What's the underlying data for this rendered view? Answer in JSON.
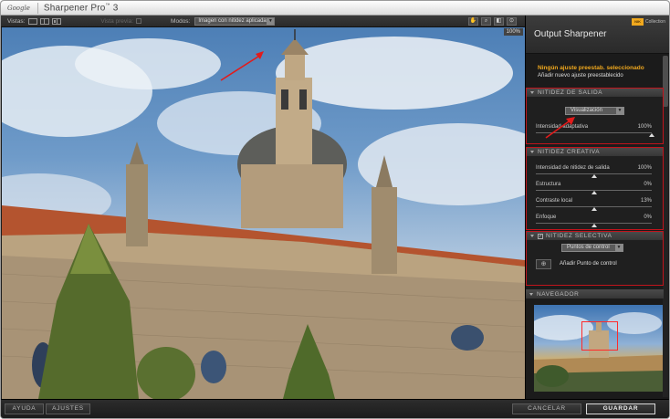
{
  "titlebar": {
    "brand": "Google",
    "app_title": "Sharpener Pro",
    "app_title_tm": "™",
    "app_version": " 3"
  },
  "toolbar": {
    "views_label": "Vistas:",
    "preview_label": "Vista previa:",
    "modes_label": "Modos:",
    "mode_value": "Imagen con nitidez aplicada",
    "tool_icons": [
      "hand-icon",
      "zoom-icon",
      "compare-icon",
      "loupe-icon"
    ]
  },
  "photo": {
    "zoom": "100%"
  },
  "panel": {
    "title": "Output Sharpener",
    "logo_box": "NIK",
    "logo_text": "Collection",
    "presets": {
      "selected": "Ningún ajuste preestab. seleccionado",
      "add": "Añadir nuevo ajuste preestablecido"
    },
    "output_sharpening": {
      "header": "NITIDEZ DE SALIDA",
      "select_value": "Visualización",
      "slider_label": "Intensidad adaptativa",
      "slider_value": "100%",
      "slider_fraction": 1.0
    },
    "creative_sharpening": {
      "header": "NITIDEZ CREATIVA",
      "sliders": [
        {
          "label": "Intensidad de nitidez de salida",
          "value": "100%",
          "fraction": 0.5
        },
        {
          "label": "Estructura",
          "value": "0%",
          "fraction": 0.5
        },
        {
          "label": "Contraste local",
          "value": "13%",
          "fraction": 0.5
        },
        {
          "label": "Enfoque",
          "value": "0%",
          "fraction": 0.5
        }
      ]
    },
    "selective_sharpening": {
      "header": "NITIDEZ SELECTIVA",
      "checked": "✓",
      "select_value": "Puntos de control",
      "add_cp_label": "Añadir Punto de control"
    },
    "navigator": {
      "header": "NAVEGADOR"
    }
  },
  "bottombar": {
    "help": "AYUDA",
    "settings": "AJUSTES",
    "cancel": "CANCELAR",
    "save": "GUARDAR"
  },
  "colors": {
    "accent_orange": "#f0a81e",
    "highlight_red": "#c0141c",
    "panel_bg": "#1b1b1b"
  }
}
